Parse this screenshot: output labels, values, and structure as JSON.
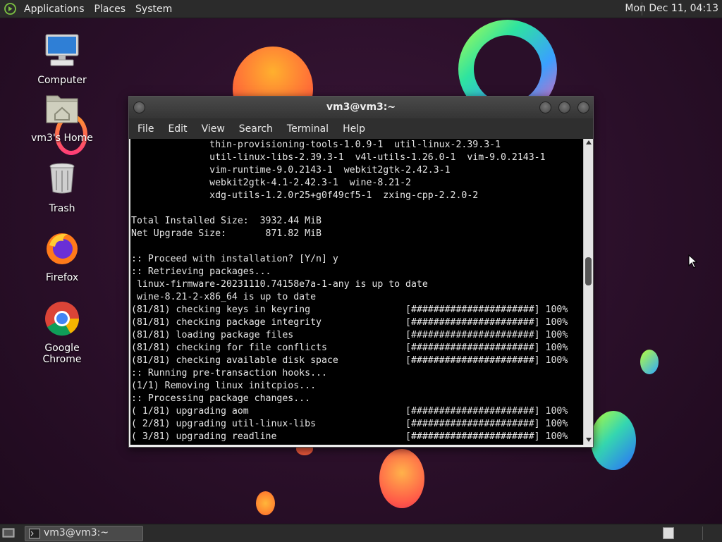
{
  "top_panel": {
    "menus": [
      "Applications",
      "Places",
      "System"
    ],
    "clock": "Mon Dec 11, 04:13"
  },
  "desktop_icons": [
    "Computer",
    "vm3's Home",
    "Trash",
    "Firefox",
    "Google Chrome"
  ],
  "terminal": {
    "title": "vm3@vm3:~",
    "menu": [
      "File",
      "Edit",
      "View",
      "Search",
      "Terminal",
      "Help"
    ],
    "lines": [
      "              thin-provisioning-tools-1.0.9-1  util-linux-2.39.3-1",
      "              util-linux-libs-2.39.3-1  v4l-utils-1.26.0-1  vim-9.0.2143-1",
      "              vim-runtime-9.0.2143-1  webkit2gtk-2.42.3-1",
      "              webkit2gtk-4.1-2.42.3-1  wine-8.21-2",
      "              xdg-utils-1.2.0r25+g0f49cf5-1  zxing-cpp-2.2.0-2",
      "",
      "Total Installed Size:  3932.44 MiB",
      "Net Upgrade Size:       871.82 MiB",
      "",
      ":: Proceed with installation? [Y/n] y",
      ":: Retrieving packages...",
      " linux-firmware-20231110.74158e7a-1-any is up to date",
      " wine-8.21-2-x86_64 is up to date",
      "(81/81) checking keys in keyring                 [######################] 100%",
      "(81/81) checking package integrity               [######################] 100%",
      "(81/81) loading package files                    [######################] 100%",
      "(81/81) checking for file conflicts              [######################] 100%",
      "(81/81) checking available disk space            [######################] 100%",
      ":: Running pre-transaction hooks...",
      "(1/1) Removing linux initcpios...",
      ":: Processing package changes...",
      "( 1/81) upgrading aom                            [######################] 100%",
      "( 2/81) upgrading util-linux-libs                [######################] 100%",
      "( 3/81) upgrading readline                       [######################] 100%"
    ]
  },
  "taskbar": {
    "task_label": "vm3@vm3:~"
  }
}
